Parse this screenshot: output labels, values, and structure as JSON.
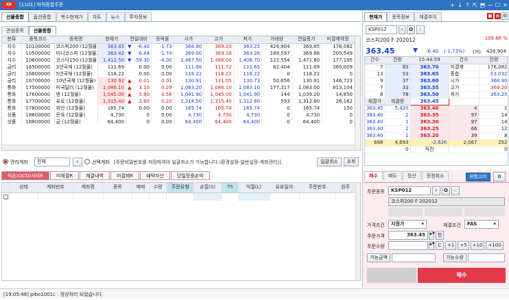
{
  "window": {
    "logo": "KB",
    "title": "[1101] 파워종합주문",
    "controls": [
      "+",
      "↓",
      "?",
      "⇱",
      "⬒",
      "—",
      "☐",
      "✕"
    ]
  },
  "left_top_tabs": [
    "선물종합",
    "옵션종합",
    "복수현재가",
    "차트",
    "뉴스",
    "투자정보"
  ],
  "left_sub_tabs": [
    "관심종목",
    "선물종합"
  ],
  "futures_table": {
    "headers": [
      "분류",
      "종목코드",
      "종목명",
      "현재가",
      "전일대비",
      "등락률",
      "시가",
      "고가",
      "저가",
      "거래량",
      "전일종가",
      "미결제약정"
    ],
    "rows": [
      [
        "지수",
        "10100000",
        "코스피200 (12월물)",
        "363.45",
        "▼",
        "-6.40",
        "-1.73",
        "368.90",
        "369.20",
        "363.25",
        "426,904",
        "369.85",
        "176,082"
      ],
      [
        "지수",
        "10500000",
        "미니코스피 (12월물)",
        "363.42",
        "▼",
        "-6.44",
        "-1.74",
        "369.00",
        "369.16",
        "363.26",
        "189,597",
        "369.86",
        "205,549"
      ],
      [
        "지수",
        "10600000",
        "코스닥150 (12월물)",
        "1,412.50",
        "▼",
        "-59.30",
        "-4.00",
        "1,467.50",
        "1,486.00",
        "1,408.70",
        "122,554",
        "1,471.80",
        "177,195"
      ],
      [
        "금리",
        "16500000",
        "3년국채 (12월물)",
        "111.69",
        "",
        "0.00",
        "0.00",
        "111.68",
        "111.72",
        "111.65",
        "82,404",
        "111.69",
        "360,009"
      ],
      [
        "금리",
        "16600000",
        "5년국채 (12월물)",
        "118.22",
        "",
        "0.00",
        "0.00",
        "118.22",
        "118.22",
        "118.22",
        "0",
        "118.22",
        "0"
      ],
      [
        "금리",
        "16700000",
        "10년국채 (12월물)",
        "130.92",
        "▲",
        "0.01",
        "0.01",
        "130.91",
        "131.05",
        "130.73",
        "50,656",
        "130.91",
        "146,723"
      ],
      [
        "통화",
        "17500000",
        "미국달러 (12월물)",
        "1,086.10",
        "▲",
        "3.10",
        "0.29",
        "1,083.20",
        "1,086.10",
        "1,083.10",
        "177,317",
        "1,083.00",
        "813,104"
      ],
      [
        "통화",
        "17600000",
        "엔 (12월물)",
        "1,045.00",
        "▲",
        "5.80",
        "0.56",
        "1,041.90",
        "1,045.00",
        "1,041.90",
        "144",
        "1,039.20",
        "14,850"
      ],
      [
        "통화",
        "17700000",
        "유로 (12월물)",
        "1,315.40",
        "▲",
        "2.60",
        "0.20",
        "1,314.50",
        "1,315.40",
        "1,312.80",
        "593",
        "1,312.80",
        "26,162"
      ],
      [
        "통화",
        "17800000",
        "위안 (12월물)",
        "165.74",
        "",
        "0.00",
        "0.00",
        "165.74",
        "165.74",
        "165.74",
        "0",
        "165.74",
        "150"
      ],
      [
        "상품",
        "18600000",
        "돈육 (12월물)",
        "4,730",
        "",
        "0",
        "0.00",
        "4,730",
        "4,730",
        "4,730",
        "0",
        "4,730",
        "0"
      ],
      [
        "상품",
        "18800000",
        "금 (12월물)",
        "64,400",
        "",
        "0",
        "0.00",
        "64,400",
        "64,400",
        "64,400",
        "0",
        "64,400",
        "0"
      ]
    ]
  },
  "account_bar": {
    "radio1": "관리계좌",
    "select": "전체",
    "radio2": "선택계좌",
    "notice": "[주문비밀번호를 저장하여야 일괄취소가 가능합니다.(환경설정-일반설정-계좌관리)]",
    "cancel_all": "일괄취소",
    "query": "조회"
  },
  "order_tabs": [
    "익손(OCO)서비R",
    "미체결R",
    "체결내역",
    "미결제R",
    "예탁자산",
    "당일장중손익"
  ],
  "order_headers": [
    "상태",
    "계좌번호",
    "계좌명",
    "종목",
    "매매",
    "수량",
    "주문유형",
    "손절(S)",
    "TS",
    "익절(L)",
    "유효일자",
    "주문번호",
    "원주"
  ],
  "quote": {
    "tabs": [
      "현재가",
      "종목정보",
      "체결추이"
    ],
    "code": "KSP012",
    "name": "코스피200 F 202012",
    "price": "363.45",
    "arrow": "▼",
    "change": "-6.40",
    "rate": "(-1.73%)",
    "volume": "426,904",
    "vol_prefix": "(거)",
    "ratio": "109.66 %",
    "ask_headers": [
      "건수",
      "잔량",
      "15:44:59",
      "건수",
      "잔량"
    ],
    "asks": [
      [
        "7",
        "83",
        "363.70"
      ],
      [
        "13",
        "53",
        "363.65"
      ],
      [
        "9",
        "37",
        "363.60"
      ],
      [
        "7",
        "33",
        "363.55"
      ],
      [
        "8",
        "78",
        "363.50"
      ]
    ],
    "info": [
      [
        "미결제",
        "176,082"
      ],
      [
        "종합",
        "-53,032"
      ],
      [
        "시가",
        "368.90"
      ],
      [
        "고가",
        "369.20"
      ],
      [
        "저가",
        "363.25"
      ]
    ],
    "bid_left_headers": [
      "체결가",
      "체결량"
    ],
    "ticks": [
      [
        "363.45",
        "5,420"
      ],
      [
        "363.40",
        "2"
      ],
      [
        "363.40",
        "1"
      ],
      [
        "363.40",
        "2"
      ],
      [
        "363.40",
        "1"
      ]
    ],
    "current": "363.45",
    "bids": [
      [
        "363.40",
        "4",
        "1"
      ],
      [
        "363.35",
        "97",
        "14"
      ],
      [
        "363.30",
        "97",
        "14"
      ],
      [
        "363.25",
        "66",
        "12"
      ],
      [
        "363.20",
        "39",
        "8"
      ]
    ],
    "totals": [
      "688",
      "4,693",
      "-2,626",
      "2,067",
      "252"
    ],
    "bottom": [
      "0",
      "직전",
      "0"
    ]
  },
  "order": {
    "tabs": [
      "매수",
      "매도",
      "정산",
      "정정취소"
    ],
    "risk": "위험고지",
    "label_code": "주문종목",
    "code": "KSP012",
    "name": "코스피200 F 202012",
    "label_cond": "가격조건",
    "cond": "지정가",
    "label_exec": "체결조건",
    "exec": "FAS",
    "label_price": "주문가격",
    "price": "363.45",
    "price_btn": "현",
    "label_qty": "주문수량",
    "qty_btns": [
      "C",
      "+1",
      "+5",
      "+10",
      "+100"
    ],
    "avail_amt": "가능금액",
    "avail_qty": "가능수량",
    "buy_btn": "매수"
  },
  "status": "[19:05:48] pibo1001c : 정상처리 되었습니다."
}
